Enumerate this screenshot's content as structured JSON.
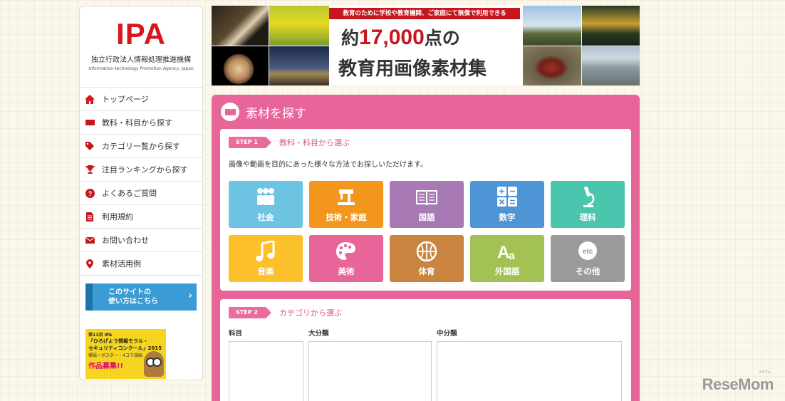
{
  "logo": {
    "mark": "IPA",
    "name_jp": "独立行政法人情報処理推進機構",
    "name_en": "Information-technology Promotion Agency, Japan"
  },
  "sidebar": {
    "items": [
      {
        "label": "トップページ",
        "icon": "home-icon"
      },
      {
        "label": "教科・科目から探す",
        "icon": "book-icon"
      },
      {
        "label": "カテゴリ一覧から探す",
        "icon": "tag-icon"
      },
      {
        "label": "注目ランキングから探す",
        "icon": "trophy-icon"
      },
      {
        "label": "よくあるご質問",
        "icon": "question-icon"
      },
      {
        "label": "利用規約",
        "icon": "document-icon"
      },
      {
        "label": "お問い合わせ",
        "icon": "mail-icon"
      },
      {
        "label": "素材活用例",
        "icon": "pin-icon"
      }
    ],
    "howto": {
      "line1": "このサイトの",
      "line2": "使い方はこちら"
    },
    "contest": {
      "line1": "第11回 IPA",
      "line2": "「ひろげよう情報モラル・",
      "line3": "セキュリティコンクール」2015",
      "line4": "標語・ポスター・4コマ漫画",
      "line5": "作品募集!!"
    }
  },
  "banner": {
    "tagline": "教育のために学校や教育機関、ご家庭にて無償で利用できる",
    "count_prefix": "約",
    "count": "17,000",
    "count_suffix": "点の",
    "subtitle": "教育用画像素材集"
  },
  "search": {
    "title": "素材を探す",
    "step1": {
      "badge": "STEP 1",
      "label": "教科・科目から選ぶ",
      "description": "画像や動画を目的にあった様々な方法でお探しいただけます。",
      "subjects": [
        {
          "label": "社会",
          "color": "#6cc4e2",
          "icon": "people-icon"
        },
        {
          "label": "技術・家庭",
          "color": "#f2961c",
          "icon": "sewing-machine-icon"
        },
        {
          "label": "国語",
          "color": "#a779b5",
          "icon": "open-book-icon"
        },
        {
          "label": "数学",
          "color": "#4d95d4",
          "icon": "calculator-icon"
        },
        {
          "label": "理科",
          "color": "#4bc6ae",
          "icon": "microscope-icon"
        },
        {
          "label": "音楽",
          "color": "#fcc02a",
          "icon": "music-note-icon"
        },
        {
          "label": "美術",
          "color": "#e8659a",
          "icon": "palette-icon"
        },
        {
          "label": "体育",
          "color": "#c9853f",
          "icon": "ball-icon"
        },
        {
          "label": "外国語",
          "color": "#a4c153",
          "icon": "letters-icon"
        },
        {
          "label": "その他",
          "color": "#9b9b9b",
          "icon": "etc-icon",
          "icon_text": "etc"
        }
      ]
    },
    "step2": {
      "badge": "STEP 2",
      "label": "カテゴリから選ぶ",
      "col1": "科目",
      "col2": "大分類",
      "col3": "中分類"
    }
  },
  "watermark": {
    "text": "ReseMom",
    "small": "リセマム"
  }
}
